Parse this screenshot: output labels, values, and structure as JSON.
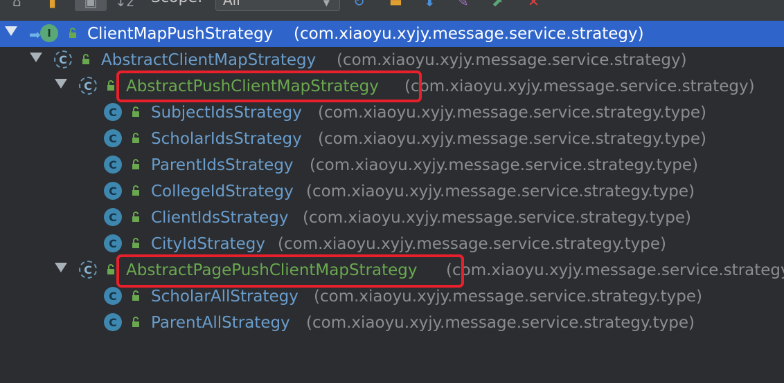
{
  "toolbar": {
    "scope_label": "Scope:",
    "scope_value": "All",
    "icons": [
      "hierarchy-icon",
      "bookmark-icon",
      "type-hierarchy-icon",
      "sort-alpha-icon",
      "refresh-icon",
      "export-icon",
      "download-icon",
      "pin-icon",
      "open-icon",
      "close-icon"
    ]
  },
  "tree": {
    "rows": [
      {
        "name": "ClientMapPushStrategy",
        "pkg": "(com.xiaoyu.xyjy.message.service.strategy)",
        "kind": "interface",
        "expanded": true
      },
      {
        "name": "AbstractClientMapStrategy",
        "pkg": "(com.xiaoyu.xyjy.message.service.strategy)",
        "kind": "abstract-class",
        "expanded": true
      },
      {
        "name": "AbstractPushClientMapStrategy",
        "pkg": "(com.xiaoyu.xyjy.message.service.strategy)",
        "kind": "abstract-class",
        "expanded": true
      },
      {
        "name": "SubjectIdsStrategy",
        "pkg": "(com.xiaoyu.xyjy.message.service.strategy.type)",
        "kind": "class"
      },
      {
        "name": "ScholarIdsStrategy",
        "pkg": "(com.xiaoyu.xyjy.message.service.strategy.type)",
        "kind": "class"
      },
      {
        "name": "ParentIdsStrategy",
        "pkg": "(com.xiaoyu.xyjy.message.service.strategy.type)",
        "kind": "class"
      },
      {
        "name": "CollegeIdStrategy",
        "pkg": "(com.xiaoyu.xyjy.message.service.strategy.type)",
        "kind": "class"
      },
      {
        "name": "ClientIdsStrategy",
        "pkg": "(com.xiaoyu.xyjy.message.service.strategy.type)",
        "kind": "class"
      },
      {
        "name": "CityIdStrategy",
        "pkg": "(com.xiaoyu.xyjy.message.service.strategy.type)",
        "kind": "class"
      },
      {
        "name": "AbstractPagePushClientMapStrategy",
        "pkg": "(com.xiaoyu.xyjy.message.service.strategy)",
        "kind": "abstract-class",
        "expanded": true
      },
      {
        "name": "ScholarAllStrategy",
        "pkg": "(com.xiaoyu.xyjy.message.service.strategy.type)",
        "kind": "class"
      },
      {
        "name": "ParentAllStrategy",
        "pkg": "(com.xiaoyu.xyjy.message.service.strategy.type)",
        "kind": "class"
      }
    ]
  },
  "badges": {
    "class_letter": "C",
    "interface_letter": "I"
  },
  "colors": {
    "selection": "#2f65ca",
    "class_name": "#6a9dcc",
    "highlighted_name": "#6aa84f",
    "package": "#8b8e91",
    "annotation_box": "#e8202b"
  }
}
